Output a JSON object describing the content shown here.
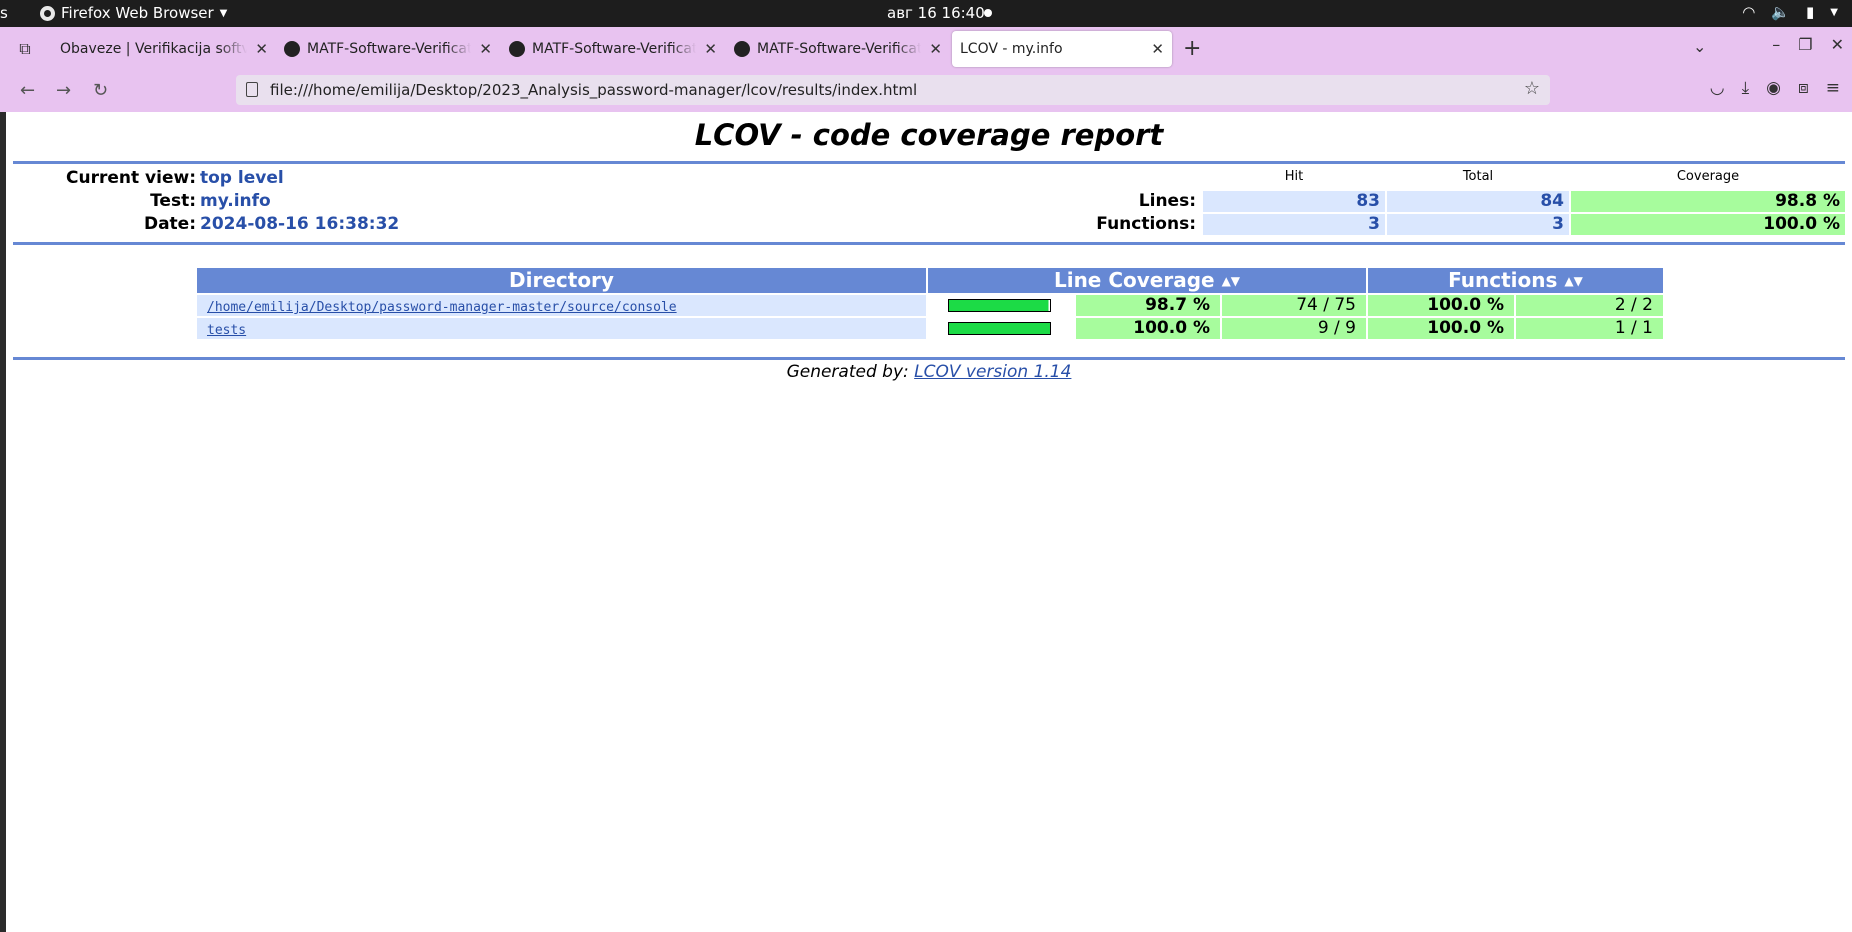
{
  "system": {
    "left_fragment": "s",
    "app_name": "Firefox Web Browser",
    "clock": "авг 16  16:40"
  },
  "browser": {
    "tabs": [
      {
        "title": "Obaveze | Verifikacija softvera",
        "has_icon": false
      },
      {
        "title": "MATF-Software-Verification",
        "has_icon": true
      },
      {
        "title": "MATF-Software-Verification",
        "has_icon": true
      },
      {
        "title": "MATF-Software-Verification",
        "has_icon": true
      },
      {
        "title": "LCOV - my.info",
        "has_icon": false,
        "active": true
      }
    ],
    "url": "file:///home/emilija/Desktop/2023_Analysis_password-manager/lcov/results/index.html"
  },
  "report": {
    "title": "LCOV - code coverage report",
    "summary": {
      "current_view_label": "Current view:",
      "current_view_value": "top level",
      "test_label": "Test:",
      "test_value": "my.info",
      "date_label": "Date:",
      "date_value": "2024-08-16 16:38:32",
      "col_hit": "Hit",
      "col_total": "Total",
      "col_coverage": "Coverage",
      "lines_label": "Lines:",
      "lines_hit": "83",
      "lines_total": "84",
      "lines_coverage": "98.8 %",
      "functions_label": "Functions:",
      "functions_hit": "3",
      "functions_total": "3",
      "functions_coverage": "100.0 %"
    },
    "table": {
      "headers": {
        "directory": "Directory",
        "line_coverage": "Line Coverage",
        "functions": "Functions"
      },
      "rows": [
        {
          "directory": "/home/emilija/Desktop/password-manager-master/source/console",
          "line_pct": "98.7 %",
          "line_frac": "74 / 75",
          "line_ratio": 0.987,
          "func_pct": "100.0 %",
          "func_frac": "2 / 2"
        },
        {
          "directory": "tests",
          "line_pct": "100.0 %",
          "line_frac": "9 / 9",
          "line_ratio": 1.0,
          "func_pct": "100.0 %",
          "func_frac": "1 / 1"
        }
      ]
    },
    "footer": {
      "prefix": "Generated by:",
      "link": "LCOV version 1.14"
    }
  },
  "colors": {
    "header_blue": "#6688d4",
    "value_blue": "#284fa8",
    "light_blue": "#dae7fe",
    "hi_green": "#a7fc9d",
    "bar_green": "#1cdb46",
    "tab_strip": "#e8c3f0"
  }
}
